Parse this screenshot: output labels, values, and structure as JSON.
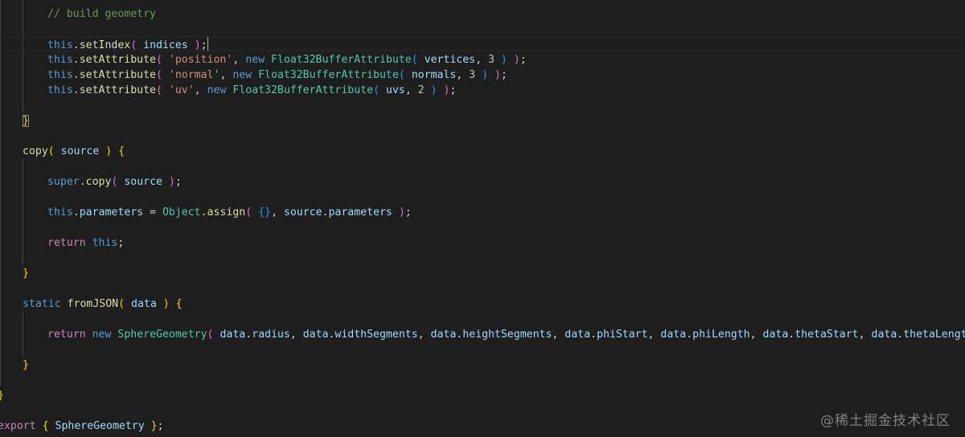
{
  "editor": {
    "lines": {
      "l1": {
        "comment": "// build geometry"
      },
      "l2": {
        "this": "this",
        "method": "setIndex",
        "arg": "indices"
      },
      "l3": {
        "this": "this",
        "method": "setAttribute",
        "str": "'position'",
        "new": "new",
        "cls": "Float32BufferAttribute",
        "arg": "vertices",
        "num": "3"
      },
      "l4": {
        "this": "this",
        "method": "setAttribute",
        "str": "'normal'",
        "new": "new",
        "cls": "Float32BufferAttribute",
        "arg": "normals",
        "num": "3"
      },
      "l5": {
        "this": "this",
        "method": "setAttribute",
        "str": "'uv'",
        "new": "new",
        "cls": "Float32BufferAttribute",
        "arg": "uvs",
        "num": "2"
      },
      "l6": {
        "brace": "}"
      },
      "l7": {
        "fn": "copy",
        "arg": "source"
      },
      "l8": {
        "super": "super",
        "method": "copy",
        "arg": "source"
      },
      "l9": {
        "this": "this",
        "prop": "parameters",
        "obj": "Object",
        "method": "assign",
        "arg": "source",
        "prop2": "parameters"
      },
      "l10": {
        "ret": "return",
        "this": "this"
      },
      "l11": {
        "brace": "}"
      },
      "l12": {
        "static": "static",
        "fn": "fromJSON",
        "arg": "data"
      },
      "l13": {
        "ret": "return",
        "new": "new",
        "cls": "SphereGeometry",
        "args": [
          "data",
          "radius",
          "data",
          "widthSegments",
          "data",
          "heightSegments",
          "data",
          "phiStart",
          "data",
          "phiLength",
          "data",
          "thetaStart",
          "data",
          "thetaLength"
        ]
      },
      "l14": {
        "brace": "}"
      },
      "l15": {
        "brace": "}"
      },
      "l16": {
        "export": "export",
        "cls": "SphereGeometry"
      }
    }
  },
  "watermark": "@稀土掘金技术社区"
}
